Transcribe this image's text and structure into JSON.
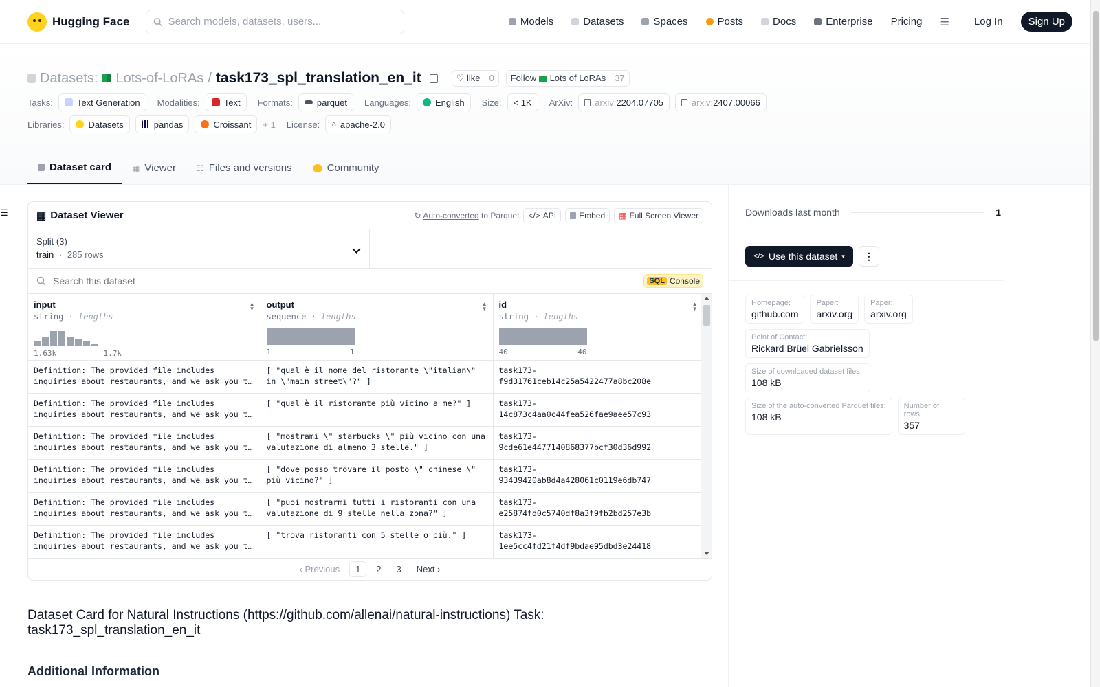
{
  "nav": {
    "brand": "Hugging Face",
    "search_placeholder": "Search models, datasets, users...",
    "links": [
      {
        "label": "Models",
        "color": "#9ca3af"
      },
      {
        "label": "Datasets",
        "color": "#d1d5db"
      },
      {
        "label": "Spaces",
        "color": "#9ca3af"
      },
      {
        "label": "Posts",
        "color": "#f59e0b"
      },
      {
        "label": "Docs",
        "color": "#d1d5db"
      },
      {
        "label": "Enterprise",
        "color": "#6b7280"
      }
    ],
    "pricing": "Pricing",
    "login": "Log In",
    "signup": "Sign Up"
  },
  "header": {
    "breadcrumb_root": "Datasets:",
    "owner": "Lots-of-LoRAs",
    "slash": "/",
    "name": "task173_spl_translation_en_it",
    "like_label": "like",
    "like_count": "0",
    "follow_label": "Follow",
    "follow_org": "Lots of LoRAs",
    "follow_count": "37",
    "meta": {
      "tasks_label": "Tasks:",
      "task": "Text Generation",
      "modalities_label": "Modalities:",
      "modality": "Text",
      "formats_label": "Formats:",
      "format": "parquet",
      "languages_label": "Languages:",
      "language": "English",
      "size_label": "Size:",
      "size": "< 1K",
      "arxiv_label": "ArXiv:",
      "arxiv_prefix": "arxiv:",
      "arxiv1": "2204.07705",
      "arxiv2": "2407.00066",
      "libraries_label": "Libraries:",
      "lib1": "Datasets",
      "lib2": "pandas",
      "lib3": "Croissant",
      "lib_more": "+ 1",
      "license_label": "License:",
      "license": "apache-2.0"
    },
    "tabs": [
      "Dataset card",
      "Viewer",
      "Files and versions",
      "Community"
    ]
  },
  "viewer": {
    "title": "Dataset Viewer",
    "auto_converted": "Auto-converted",
    "to_parquet": "to Parquet",
    "api": "API",
    "embed": "Embed",
    "full_screen": "Full Screen Viewer",
    "split_label": "Split (3)",
    "split_name": "train",
    "split_dot": "·",
    "split_rows": "285 rows",
    "search_placeholder": "Search this dataset",
    "sql": "SQL",
    "console": "Console",
    "columns": [
      {
        "name": "input",
        "type": "string",
        "stat": "lengths",
        "min": "1.63k",
        "max": "1.7k"
      },
      {
        "name": "output",
        "type": "sequence",
        "stat": "lengths",
        "min": "1",
        "max": "1"
      },
      {
        "name": "id",
        "type": "string",
        "stat": "lengths",
        "min": "40",
        "max": "40"
      }
    ],
    "input_histogram": [
      0.3,
      0.5,
      0.85,
      0.85,
      0.55,
      0.4,
      0.28,
      0.1,
      0.05,
      0.05
    ],
    "rows": [
      {
        "input": "Definition: The provided file includes inquiries about restaurants, and we ask you to translate those to the Italian language.",
        "output": "[ \"qual è il nome del ristorante \\\"italian\\\" in \\\"main street\\\"?\" ]",
        "id": "task173-\nf9d31761ceb14c25a5422477a8bc208e"
      },
      {
        "input": "Definition: The provided file includes inquiries about restaurants, and we ask you to translate those to the Italian language.",
        "output": "[ \"qual è il ristorante più vicino a me?\" ]",
        "id": "task173-\n14c873c4aa0c44fea526fae9aee57c93"
      },
      {
        "input": "Definition: The provided file includes inquiries about restaurants, and we ask you to translate those to the Italian language.",
        "output": "[ \"mostrami \\\" starbucks \\\" più vicino con una valutazione di almeno 3 stelle.\" ]",
        "id": "task173-\n9cde61e4477140868377bcf30d36d992"
      },
      {
        "input": "Definition: The provided file includes inquiries about restaurants, and we ask you to translate those to the Italian language.",
        "output": "[ \"dove posso trovare il posto \\\" chinese \\\" più vicino?\" ]",
        "id": "task173-\n93439420ab8d4a428061c0119e6db747"
      },
      {
        "input": "Definition: The provided file includes inquiries about restaurants, and we ask you to translate those to the Italian language.",
        "output": "[ \"puoi mostrarmi tutti i ristoranti con una valutazione di 9 stelle nella zona?\" ]",
        "id": "task173-\ne25874fd0c5740df8a3f9fb2bd257e3b"
      },
      {
        "input": "Definition: The provided file includes inquiries about restaurants, and we ask you to translate those to the Italian language.",
        "output": "[ \"trova ristoranti con 5 stelle o più.\" ]",
        "id": "task173-\n1ee5cc4fd21f4df9bdae95dbd3e24418"
      }
    ],
    "pager": {
      "prev": "Previous",
      "pages": [
        "1",
        "2",
        "3"
      ],
      "next": "Next"
    }
  },
  "card": {
    "title_prefix": "Dataset Card for Natural Instructions (",
    "link": "https://github.com/allenai/natural-instructions",
    "title_suffix": ") Task: task173_spl_translation_en_it",
    "subheading": "Additional Information"
  },
  "sidebar": {
    "downloads_label": "Downloads last month",
    "downloads": "1",
    "use_dataset": "Use this dataset",
    "info": [
      {
        "k": "Homepage:",
        "v": "github.com"
      },
      {
        "k": "Paper:",
        "v": "arxiv.org"
      },
      {
        "k": "Paper:",
        "v": "arxiv.org"
      },
      {
        "k": "Point of Contact:",
        "v": "Rickard Brüel Gabrielsson"
      },
      {
        "k": "Size of downloaded dataset files:",
        "v": "108 kB"
      },
      {
        "k": "Size of the auto-converted Parquet files:",
        "v": "108 kB"
      },
      {
        "k": "Number of rows:",
        "v": "357"
      }
    ]
  }
}
